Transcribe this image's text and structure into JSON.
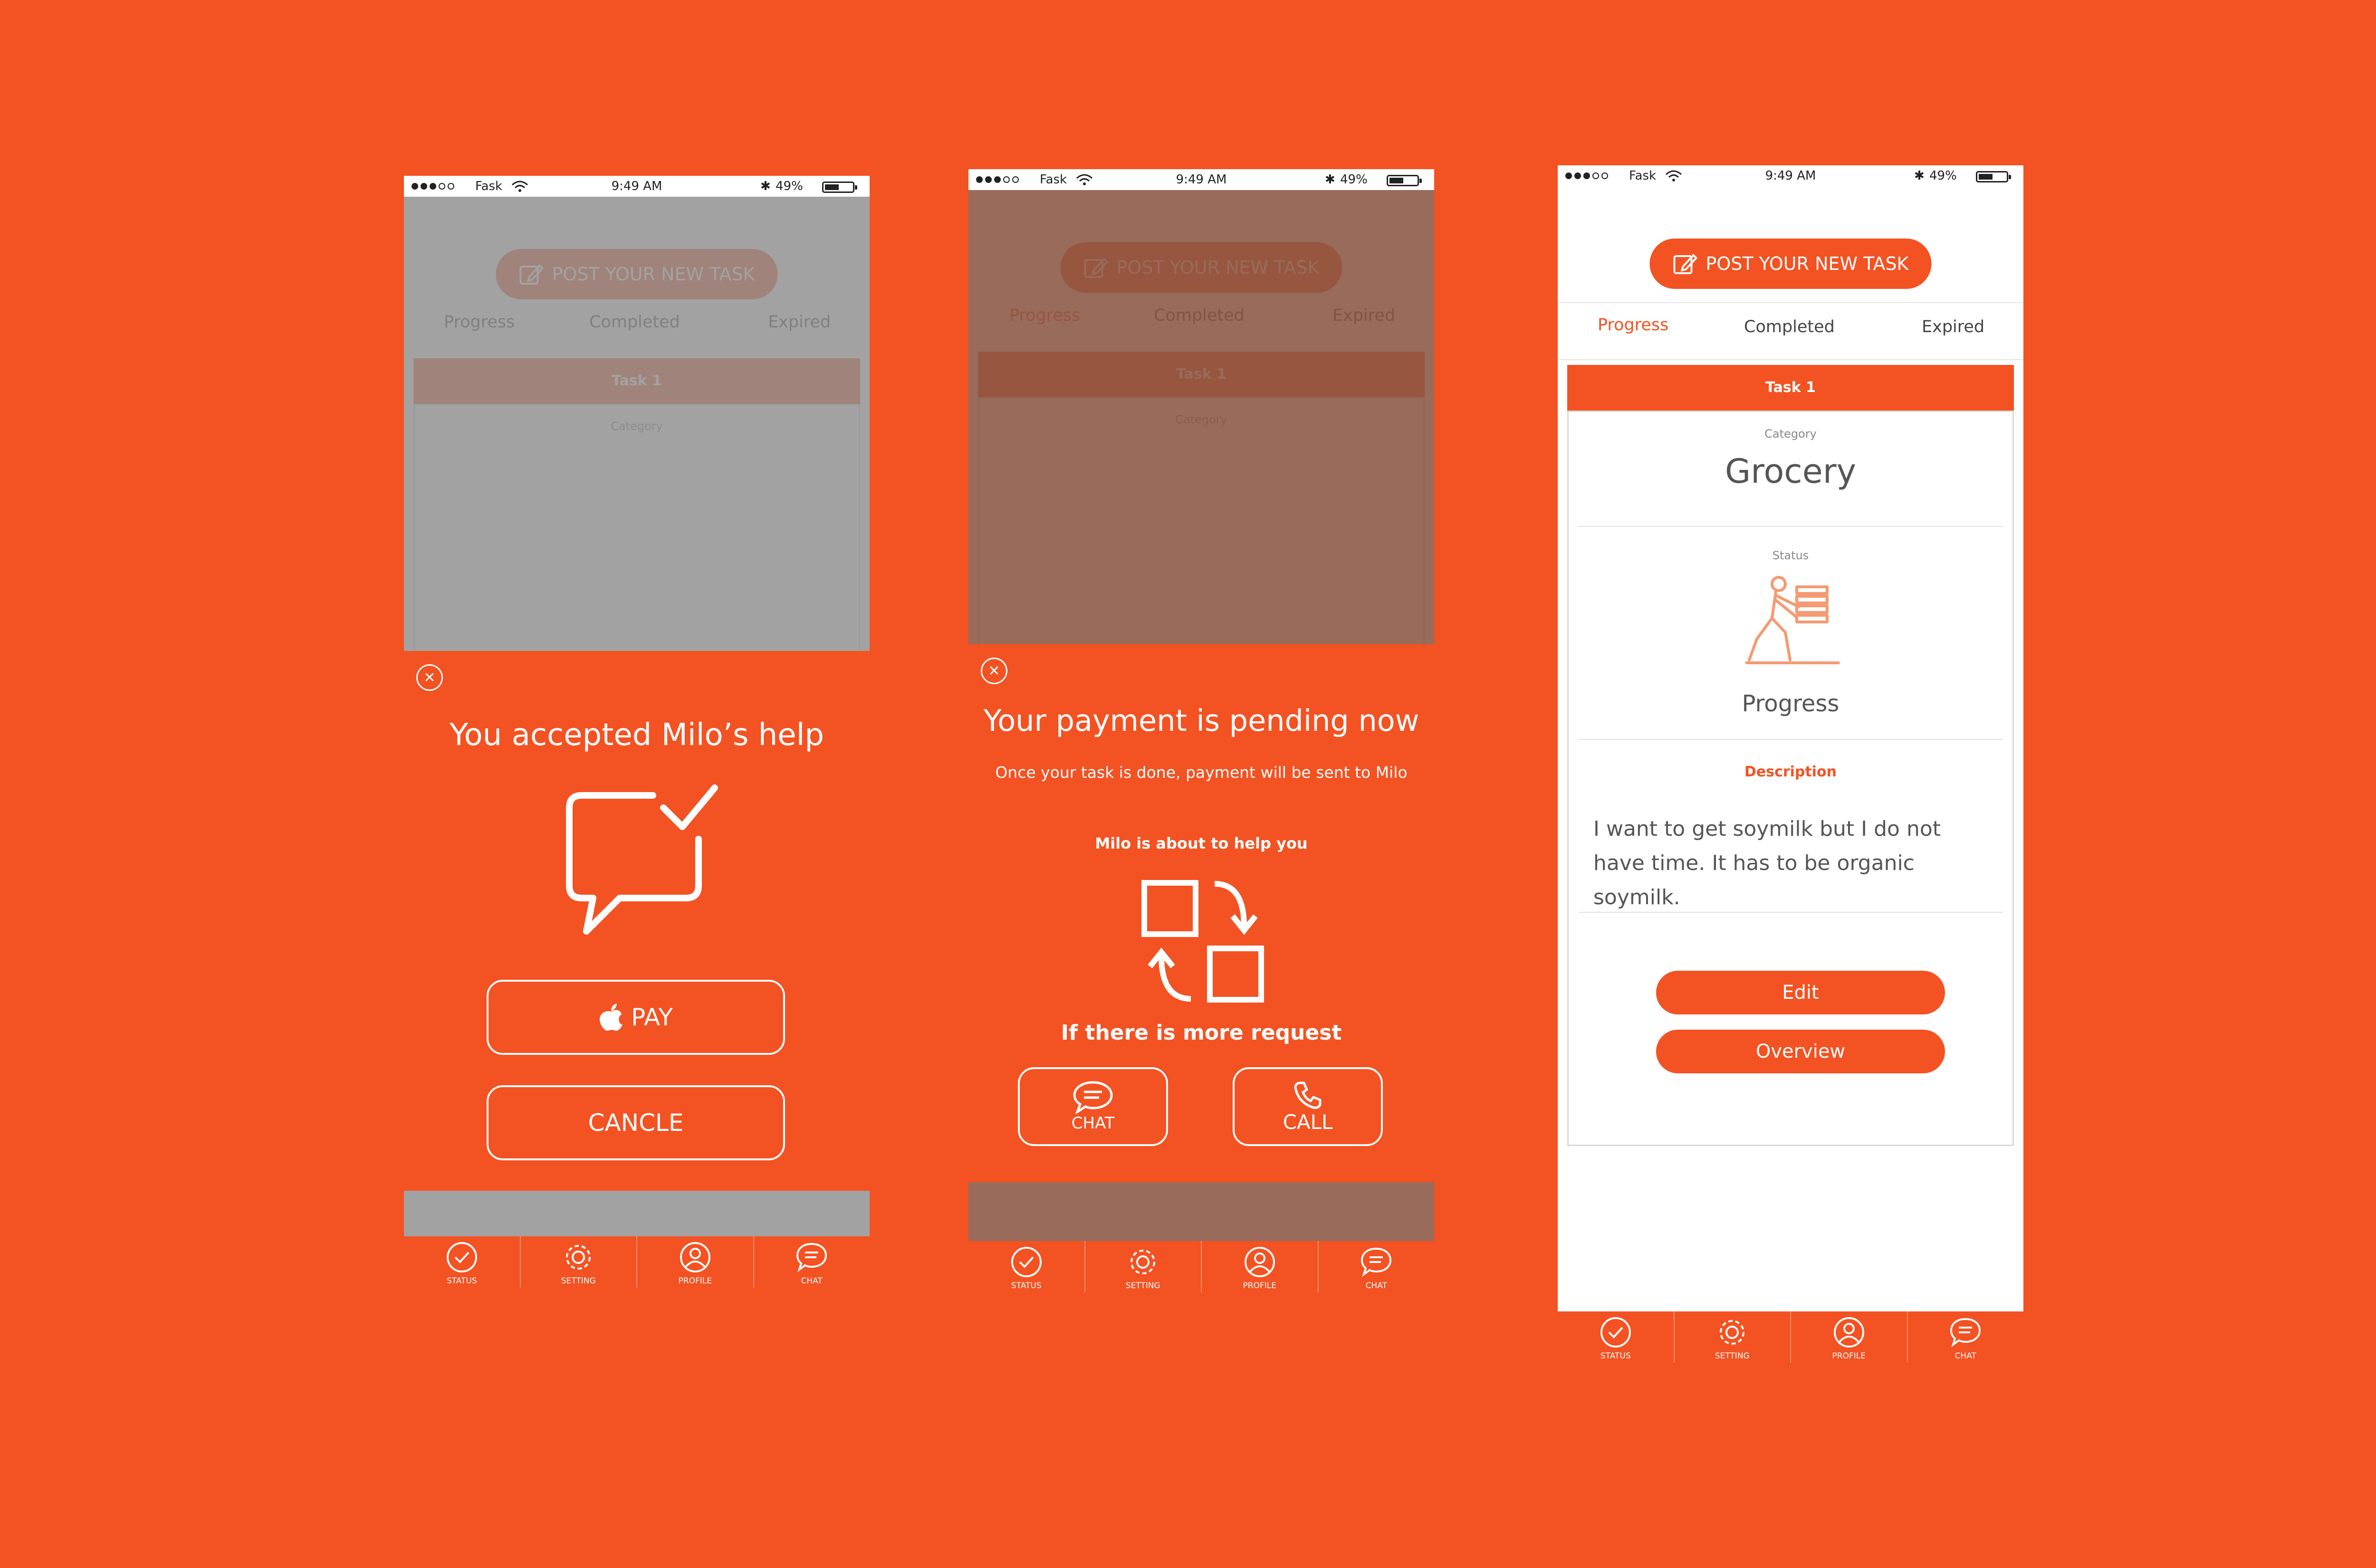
{
  "status_bar": {
    "carrier": "Fask",
    "time": "9:49 AM",
    "battery": "49%"
  },
  "post_button": "POST YOUR NEW TASK",
  "tabs": {
    "progress": "Progress",
    "completed": "Completed",
    "expired": "Expired"
  },
  "task_header": "Task 1",
  "card": {
    "category_label": "Category",
    "category_value": "Grocery",
    "status_label": "Status",
    "status_value": "Progress",
    "description_label": "Description",
    "description_text": "I want to get soymilk but I do not have time. It has to be organic soymilk.",
    "edit_button": "Edit",
    "overview_button": "Overview"
  },
  "nav": [
    {
      "label": "STATUS"
    },
    {
      "label": "SETTING"
    },
    {
      "label": "PROFILE"
    },
    {
      "label": "CHAT"
    }
  ],
  "modal1": {
    "title": "You accepted Milo’s help",
    "pay_button": "PAY",
    "cancel_button": "CANCLE"
  },
  "modal2": {
    "title": "Your payment is pending now",
    "subtitle": "Once your task is done, payment will be sent to Milo",
    "helper_text": "Milo is about to help you",
    "more_text": "If there is more request",
    "chat_button": "CHAT",
    "call_button": "CALL"
  },
  "colors": {
    "background": "#F35222",
    "accent": "#F35222",
    "modal1_overlay": "#8E8E8E",
    "modal2_overlay": "#8A5743"
  },
  "icons": {
    "edit": "edit-square-icon",
    "apple": "apple-icon",
    "close": "close-icon",
    "message_check": "message-check-icon",
    "swap": "swap-arrows-icon",
    "chat": "chat-bubble-icon",
    "phone": "phone-icon",
    "delivery": "delivery-person-icon"
  }
}
